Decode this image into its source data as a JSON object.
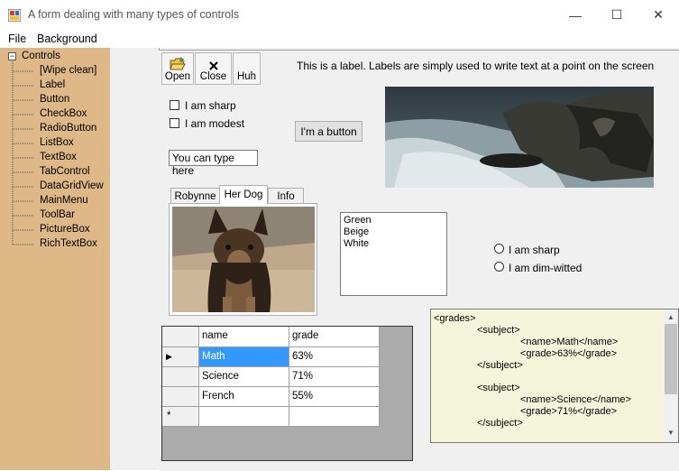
{
  "window": {
    "title": "A form dealing with many types of controls",
    "controls": {
      "minimize": "—",
      "maximize": "☐",
      "close": "✕"
    }
  },
  "menu": {
    "items": [
      "File",
      "Background"
    ]
  },
  "tree": {
    "root": "Controls",
    "toggle": "⊟",
    "children": [
      "[Wipe clean]",
      "Label",
      "Button",
      "CheckBox",
      "RadioButton",
      "ListBox",
      "TextBox",
      "TabControl",
      "DataGridView",
      "MainMenu",
      "ToolBar",
      "PictureBox",
      "RichTextBox"
    ]
  },
  "toolbar": {
    "open": "Open",
    "close": "Close",
    "huh": "Huh",
    "open_icon": "folder-open-icon",
    "close_icon": "x-icon"
  },
  "label_text": "This is a label. Labels are simply used to write text at a point on the screen",
  "checkboxes": [
    "I am sharp",
    "I am modest"
  ],
  "button_text": "I'm a button",
  "textbox_value": "You can type here",
  "tabs": [
    "Robynne",
    "Her Dog",
    "Info"
  ],
  "selected_tab": "Her Dog",
  "listbox": [
    "Green",
    "Beige",
    "White"
  ],
  "radios": [
    "I am sharp",
    "I am dim-witted"
  ],
  "grid": {
    "columns": [
      "name",
      "grade"
    ],
    "rows": [
      [
        "Math",
        "63%"
      ],
      [
        "Science",
        "71%"
      ],
      [
        "French",
        "55%"
      ]
    ],
    "current_marker": "▶",
    "new_row_marker": "*"
  },
  "richtext": {
    "lines": [
      "<grades>",
      "<subject>",
      "<name>Math</name>",
      "<grade>63%</grade>",
      "</subject>",
      "<subject>",
      "<name>Science</name>",
      "<grade>71%</grade>",
      "</subject>"
    ]
  },
  "colors": {
    "tree_bg": "#deb887",
    "rich_bg": "#f5f5dc",
    "grid_selected": "#3399ff",
    "grid_bg": "#ababab"
  }
}
